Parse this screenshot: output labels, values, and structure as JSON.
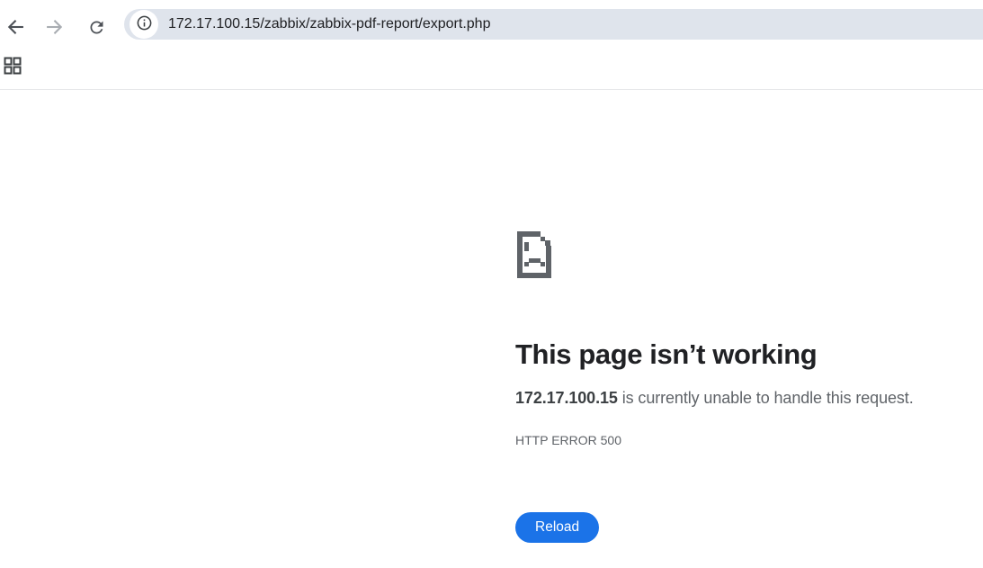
{
  "toolbar": {
    "url": "172.17.100.15/zabbix/zabbix-pdf-report/export.php",
    "icons": {
      "back": "back-arrow-icon",
      "forward": "forward-arrow-icon",
      "reload": "reload-icon",
      "site_info": "info-icon",
      "apps": "apps-grid-icon"
    }
  },
  "error_page": {
    "icon": "sad-file-icon",
    "title": "This page isn’t working",
    "host": "172.17.100.15",
    "message_rest": " is currently unable to handle this request.",
    "error_code": "HTTP ERROR 500",
    "reload_label": "Reload"
  },
  "colors": {
    "accent_blue": "#1b73e8",
    "omnibox_bg": "#dfe4ec",
    "icon_gray": "#4c5056",
    "disabled_icon_gray": "#a9adb2",
    "text_dark": "#202124",
    "text_gray": "#5f6368"
  }
}
